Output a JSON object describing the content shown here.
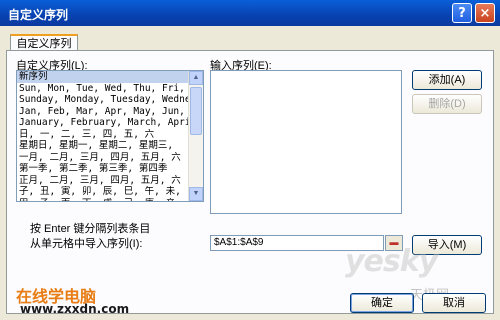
{
  "window": {
    "title": "自定义序列",
    "help_glyph": "?",
    "close_glyph": "×"
  },
  "tab": {
    "label": "自定义序列"
  },
  "custom_lists": {
    "label": "自定义序列(L):",
    "items": [
      "新序列",
      "Sun, Mon, Tue, Wed, Thu, Fri, S",
      "Sunday, Monday, Tuesday, Wednes",
      "Jan, Feb, Mar, Apr, May, Jun, J",
      "January, February, March, April",
      "日, 一, 二, 三, 四, 五, 六",
      "星期日, 星期一, 星期二, 星期三,",
      "一月, 二月, 三月, 四月, 五月, 六",
      "第一季, 第二季, 第三季, 第四季",
      "正月, 二月, 三月, 四月, 五月, 六",
      "子, 丑, 寅, 卯, 辰, 巳, 午, 未,",
      "甲, 乙, 丙, 丁, 戊, 己, 庚, 辛,"
    ],
    "selected_index": 0
  },
  "input_list": {
    "label": "输入序列(E):",
    "value": ""
  },
  "buttons": {
    "add": "添加(A)",
    "delete": "删除(D)",
    "import": "导入(M)",
    "ok": "确定",
    "cancel": "取消"
  },
  "hint": "按 Enter 键分隔列表条目",
  "import_from": {
    "label": "从单元格中导入序列(I):",
    "value": "$A$1:$A$9"
  },
  "watermarks": {
    "logo": "yesky",
    "logo_cn": "天极网",
    "site": "在线学电脑",
    "url": "www.zxxdn.com"
  }
}
